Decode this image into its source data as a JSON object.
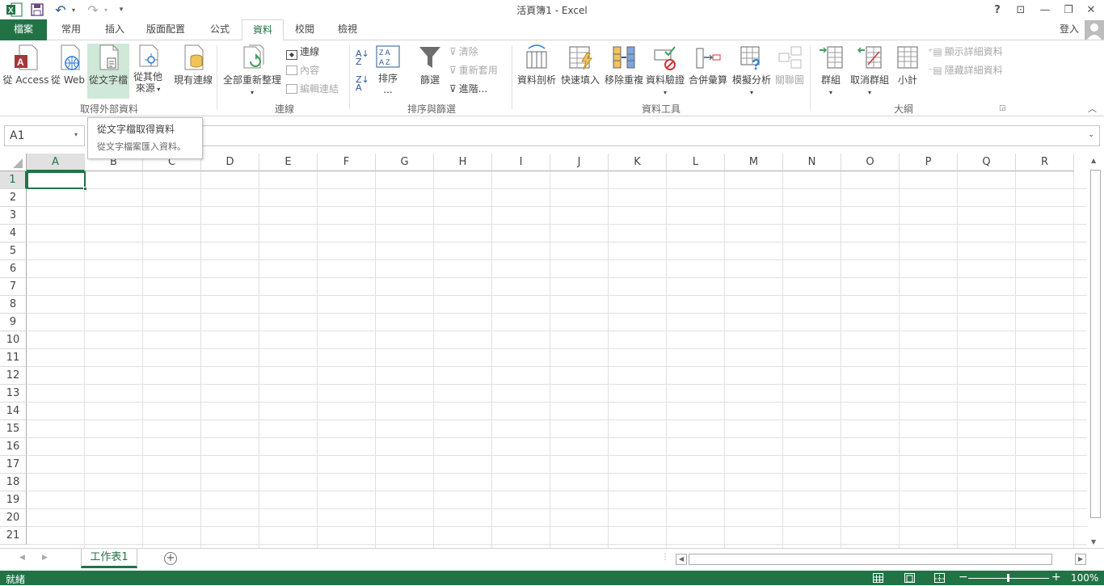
{
  "window": {
    "title": "活頁簿1 - Excel"
  },
  "title_buttons": {
    "help": "?",
    "restore_ribbon": "⊡",
    "minimize": "—",
    "maximize": "❐",
    "close": "✕"
  },
  "quick_access": {
    "excel_logo": "excel-icon",
    "save": "save-icon",
    "undo": "undo-icon",
    "redo": "redo-icon",
    "customize": "customize-icon"
  },
  "tabs": [
    "檔案",
    "常用",
    "插入",
    "版面配置",
    "公式",
    "資料",
    "校閱",
    "檢視"
  ],
  "active_tab": "資料",
  "signin": "登入",
  "ribbon": {
    "get_external": {
      "group_label": "取得外部資料",
      "from_access": "從 Access",
      "from_web": "從 Web",
      "from_text": "從文字檔",
      "from_other_1": "從其他",
      "from_other_2": "來源",
      "existing": "現有連線"
    },
    "connections": {
      "group_label": "連線",
      "refresh_all": "全部重新整理",
      "connections": "連線",
      "properties": "內容",
      "edit_links": "編輯連結"
    },
    "sort_filter": {
      "group_label": "排序與篩選",
      "sort": "排序",
      "sort_more": "...",
      "filter": "篩選",
      "clear": "清除",
      "reapply": "重新套用",
      "advanced": "進階..."
    },
    "data_tools": {
      "group_label": "資料工具",
      "text_to_columns": "資料剖析",
      "flash_fill": "快速填入",
      "remove_dup": "移除重複",
      "validation": "資料驗證",
      "consolidate": "合併彙算",
      "what_if": "模擬分析",
      "relationships": "關聯圖"
    },
    "outline": {
      "group_label": "大綱",
      "group": "群組",
      "ungroup": "取消群組",
      "subtotal": "小計",
      "show_detail": "顯示詳細資料",
      "hide_detail": "隱藏詳細資料"
    }
  },
  "tooltip": {
    "title": "從文字檔取得資料",
    "desc": "從文字檔案匯入資料。"
  },
  "formula_bar": {
    "name_box": "A1",
    "formula": ""
  },
  "columns": [
    "A",
    "B",
    "C",
    "D",
    "E",
    "F",
    "G",
    "H",
    "I",
    "J",
    "K",
    "L",
    "M",
    "N",
    "O",
    "P",
    "Q",
    "R"
  ],
  "rows": [
    "1",
    "2",
    "3",
    "4",
    "5",
    "6",
    "7",
    "8",
    "9",
    "10",
    "11",
    "12",
    "13",
    "14",
    "15",
    "16",
    "17",
    "18",
    "19",
    "20",
    "21"
  ],
  "sheet_tabs": [
    "工作表1"
  ],
  "status": {
    "ready": "就緒",
    "zoom": "100%"
  },
  "colors": {
    "accent": "#217346",
    "selection_bg": "#cfe8d7"
  }
}
